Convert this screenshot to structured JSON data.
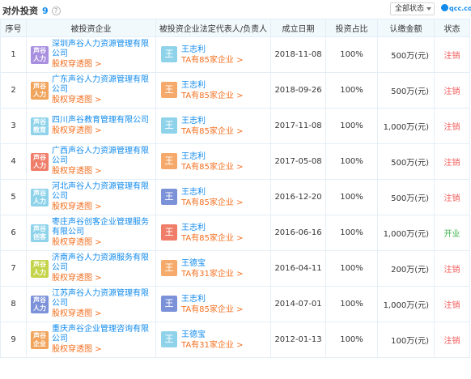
{
  "header": {
    "title": "对外投资",
    "count": "9",
    "status_filter": "全部状态",
    "watermark": "qcc.com"
  },
  "columns": [
    "序号",
    "被投资企业",
    "被投资企业法定代表人/负责人",
    "成立日期",
    "投资占比",
    "认缴金额",
    "状态"
  ],
  "equity_link_label": "股权穿透图 >",
  "rows": [
    {
      "idx": "1",
      "logo_text": "声谷人力",
      "logo_color": "#a98fe0",
      "company": "深圳声谷人力资源管理有限公司",
      "avatar": "王",
      "avatar_color": "#8fd3ea",
      "person": "王志利",
      "ta": "TA有85家企业 >",
      "date": "2018-11-08",
      "ratio": "100%",
      "amount": "500万(元)",
      "status": "注销",
      "status_type": "cancel"
    },
    {
      "idx": "2",
      "logo_text": "声谷人力",
      "logo_color": "#f0a45c",
      "company": "广东声谷人力资源管理有限公司",
      "avatar": "王",
      "avatar_color": "#f5a96a",
      "person": "王志利",
      "ta": "TA有85家企业 >",
      "date": "2018-09-26",
      "ratio": "100%",
      "amount": "500万(元)",
      "status": "注销",
      "status_type": "cancel"
    },
    {
      "idx": "3",
      "logo_text": "声谷教育",
      "logo_color": "#8fd3ea",
      "company": "四川声谷教育管理有限公司",
      "avatar": "王",
      "avatar_color": "#8fd3ea",
      "person": "王志利",
      "ta": "TA有85家企业 >",
      "date": "2017-11-08",
      "ratio": "100%",
      "amount": "1,000万(元)",
      "status": "注销",
      "status_type": "cancel"
    },
    {
      "idx": "4",
      "logo_text": "声谷人力",
      "logo_color": "#ef7d6a",
      "company": "广西声谷人力资源管理有限公司",
      "avatar": "王",
      "avatar_color": "#f5a96a",
      "person": "王志利",
      "ta": "TA有85家企业 >",
      "date": "2017-05-08",
      "ratio": "100%",
      "amount": "500万(元)",
      "status": "注销",
      "status_type": "cancel"
    },
    {
      "idx": "5",
      "logo_text": "声谷人力",
      "logo_color": "#8fd3ea",
      "company": "河北声谷人力资源管理有限公司",
      "avatar": "王",
      "avatar_color": "#7c92d8",
      "person": "王志利",
      "ta": "TA有85家企业 >",
      "date": "2016-12-20",
      "ratio": "100%",
      "amount": "500万(元)",
      "status": "注销",
      "status_type": "cancel"
    },
    {
      "idx": "6",
      "logo_text": "声谷创客",
      "logo_color": "#8fd3ea",
      "company": "枣庄声谷创客企业管理服务有限公司",
      "avatar": "王",
      "avatar_color": "#ef7d6a",
      "person": "王志利",
      "ta": "TA有85家企业 >",
      "date": "2016-06-16",
      "ratio": "100%",
      "amount": "1,000万(元)",
      "status": "开业",
      "status_type": "open"
    },
    {
      "idx": "7",
      "logo_text": "声谷人力",
      "logo_color": "#c4d44a",
      "company": "济南声谷人力资源服务有限公司",
      "avatar": "王",
      "avatar_color": "#f5a96a",
      "person": "王德宝",
      "ta": "TA有31家企业 >",
      "date": "2016-04-11",
      "ratio": "100%",
      "amount": "200万(元)",
      "status": "注销",
      "status_type": "cancel"
    },
    {
      "idx": "8",
      "logo_text": "声谷人力",
      "logo_color": "#7c92d8",
      "company": "江苏声谷人力资源管理有限公司",
      "avatar": "王",
      "avatar_color": "#7c92d8",
      "person": "王志利",
      "ta": "TA有85家企业 >",
      "date": "2014-07-01",
      "ratio": "100%",
      "amount": "1,000万(元)",
      "status": "注销",
      "status_type": "cancel"
    },
    {
      "idx": "9",
      "logo_text": "声谷企业",
      "logo_color": "#f0a45c",
      "company": "重庆声谷企业管理咨询有限公司",
      "avatar": "王",
      "avatar_color": "#8fd3ea",
      "person": "王德宝",
      "ta": "TA有31家企业 >",
      "date": "2012-01-13",
      "ratio": "100%",
      "amount": "100万(元)",
      "status": "注销",
      "status_type": "cancel"
    }
  ]
}
